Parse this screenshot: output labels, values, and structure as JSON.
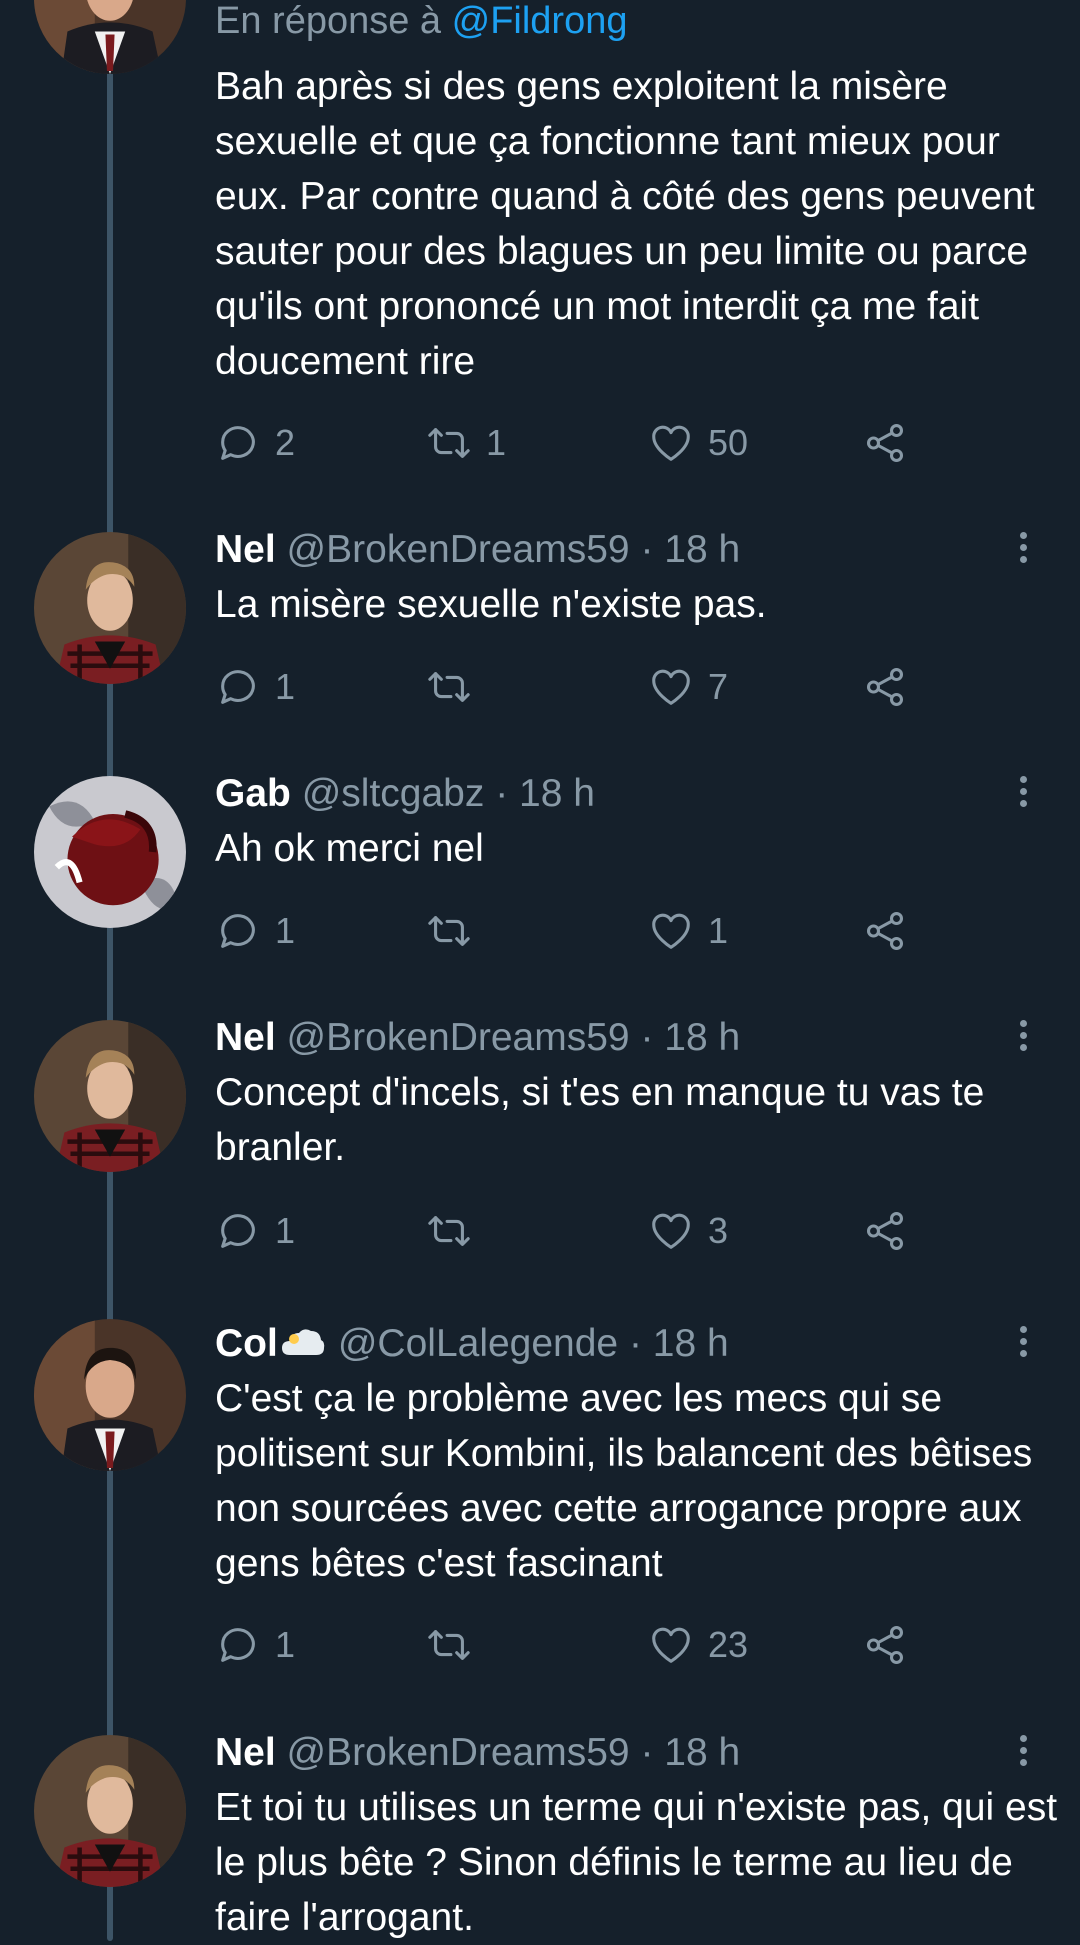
{
  "tweets": [
    {
      "reply_prefix": "En réponse à",
      "reply_mention": "@Fildrong",
      "text": "Bah après si des gens exploitent la misère sexuelle et que ça fonctionne tant mieux pour eux. Par contre quand à côté des gens peuvent sauter pour des blagues un peu limite ou parce qu'ils ont prononcé un mot interdit ça me fait doucement rire",
      "replies": "2",
      "retweets": "1",
      "likes": "50"
    },
    {
      "name": "Nel",
      "handle": "@BrokenDreams59",
      "time": "· 18 h",
      "text": "La misère sexuelle n'existe pas.",
      "replies": "1",
      "retweets": "",
      "likes": "7"
    },
    {
      "name": "Gab",
      "handle": "@sltcgabz",
      "time": "· 18 h",
      "text": "Ah ok merci nel",
      "replies": "1",
      "retweets": "",
      "likes": "1"
    },
    {
      "name": "Nel",
      "handle": "@BrokenDreams59",
      "time": "· 18 h",
      "text": "Concept d'incels, si t'es en manque tu vas te branler.",
      "replies": "1",
      "retweets": "",
      "likes": "3"
    },
    {
      "name": "Col",
      "name_emoji": "cloud-emoji",
      "handle": "@ColLalegende",
      "time": "· 18 h",
      "text": "C'est ça le problème avec les mecs qui se politisent sur Kombini, ils balancent des bêtises non sourcées avec cette arrogance propre aux gens bêtes c'est fascinant",
      "replies": "1",
      "retweets": "",
      "likes": "23"
    },
    {
      "name": "Nel",
      "handle": "@BrokenDreams59",
      "time": "· 18 h",
      "text": "Et toi tu utilises un terme qui n'existe pas, qui est le plus bête ? Sinon définis le terme au lieu de faire l'arrogant."
    }
  ],
  "colors": {
    "background": "#15202b",
    "secondary_text": "#8899a6",
    "mention": "#1da1f2",
    "thread_line": "#3d5466"
  },
  "icons": {
    "reply": "reply-icon",
    "retweet": "retweet-icon",
    "like": "heart-icon",
    "share": "share-icon",
    "more": "more-icon"
  }
}
